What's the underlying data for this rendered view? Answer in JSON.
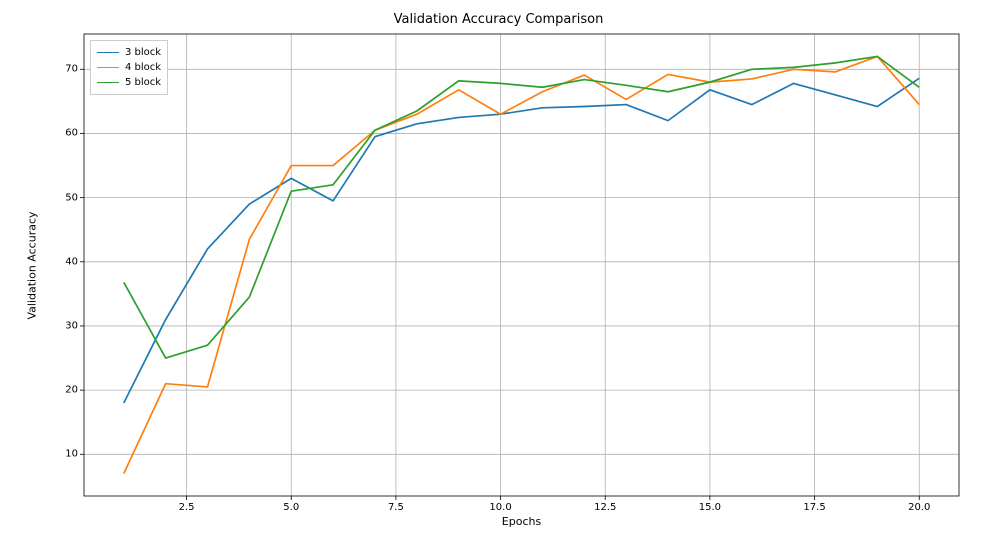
{
  "chart_data": {
    "type": "line",
    "title": "Validation Accuracy Comparison",
    "xlabel": "Epochs",
    "ylabel": "Validation Accuracy",
    "xlim": [
      0.05,
      20.95
    ],
    "ylim": [
      3.5,
      75.5
    ],
    "xticks": [
      2.5,
      5.0,
      7.5,
      10.0,
      12.5,
      15.0,
      17.5,
      20.0
    ],
    "xtick_labels": [
      "2.5",
      "5.0",
      "7.5",
      "10.0",
      "12.5",
      "15.0",
      "17.5",
      "20.0"
    ],
    "yticks": [
      10,
      20,
      30,
      40,
      50,
      60,
      70
    ],
    "ytick_labels": [
      "10",
      "20",
      "30",
      "40",
      "50",
      "60",
      "70"
    ],
    "x": [
      1,
      2,
      3,
      4,
      5,
      6,
      7,
      8,
      9,
      10,
      11,
      12,
      13,
      14,
      15,
      16,
      17,
      18,
      19,
      20
    ],
    "series": [
      {
        "name": "3 block",
        "color": "#1f77b4",
        "values": [
          18.0,
          31.0,
          42.0,
          49.0,
          53.0,
          49.5,
          59.5,
          61.5,
          62.5,
          63.0,
          64.0,
          64.2,
          64.5,
          62.0,
          66.8,
          64.5,
          67.8,
          66.0,
          64.2,
          68.6
        ]
      },
      {
        "name": "4 block",
        "color": "#ff7f0e",
        "values": [
          7.0,
          21.0,
          20.5,
          43.5,
          55.0,
          55.0,
          60.5,
          63.0,
          66.8,
          63.0,
          66.5,
          69.1,
          65.3,
          69.2,
          68.0,
          68.5,
          70.0,
          69.6,
          72.0,
          64.5
        ]
      },
      {
        "name": "5 block",
        "color": "#2ca02c",
        "values": [
          36.8,
          25.0,
          27.0,
          34.5,
          51.0,
          52.0,
          60.5,
          63.5,
          68.2,
          67.8,
          67.2,
          68.4,
          67.5,
          66.5,
          68.0,
          70.0,
          70.3,
          71.0,
          72.0,
          67.2
        ]
      }
    ],
    "legend_position": "upper left",
    "grid": true
  },
  "colors": {
    "grid": "#b0b0b0",
    "spine": "#000000"
  }
}
